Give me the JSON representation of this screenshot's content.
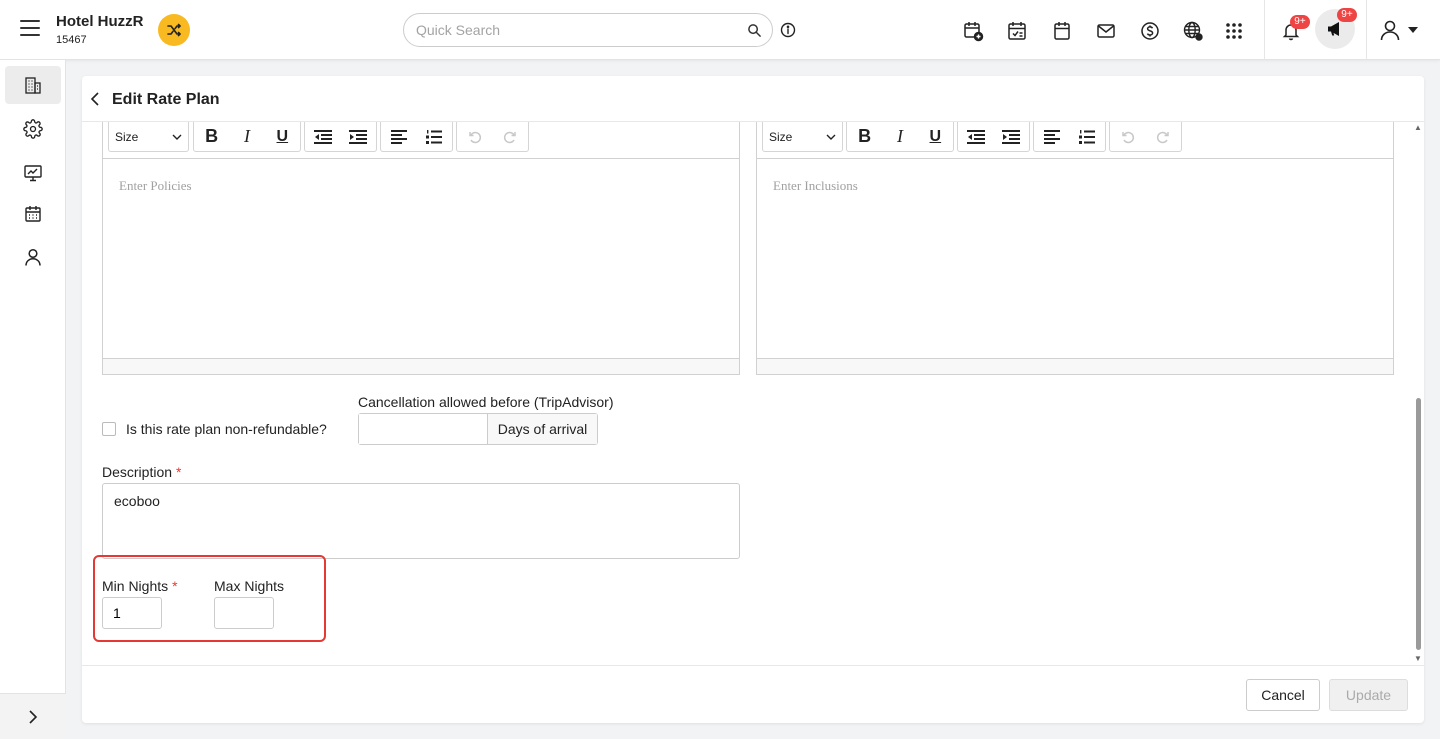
{
  "header": {
    "hotel_name": "Hotel HuzzR",
    "hotel_id": "15467",
    "search_placeholder": "Quick Search",
    "notification_badge": "9+",
    "announcement_badge": "9+",
    "accent_color": "#f9b921",
    "icons": [
      "menu-icon",
      "shuffle-icon",
      "search-icon",
      "info-icon",
      "calendar-add-icon",
      "calendar-check-icon",
      "calendar-icon",
      "mail-icon",
      "dollar-icon",
      "globe-icon",
      "apps-grid-icon",
      "bell-icon",
      "megaphone-icon",
      "user-icon",
      "caret-down-icon"
    ]
  },
  "sidebar": {
    "items": [
      "building-icon",
      "gear-icon",
      "monitor-icon",
      "calendar-grid-icon",
      "user-icon"
    ],
    "expand_icon": "chevron-right-icon"
  },
  "page": {
    "title": "Edit Rate Plan",
    "policies_editor": {
      "size_label": "Size",
      "placeholder": "Enter Policies"
    },
    "inclusions_editor": {
      "size_label": "Size",
      "placeholder": "Enter Inclusions"
    },
    "non_refundable_label": "Is this rate plan non-refundable?",
    "non_refundable_checked": false,
    "cancellation_label": "Cancellation allowed before (TripAdvisor)",
    "cancellation_value": "",
    "cancellation_addon": "Days of arrival",
    "description_label": "Description",
    "required_mark": "*",
    "description_value": "ecoboo",
    "min_nights_label": "Min Nights",
    "min_nights_value": "1",
    "max_nights_label": "Max Nights",
    "max_nights_value": "",
    "highlight_color": "#e53935"
  },
  "footer": {
    "cancel_label": "Cancel",
    "update_label": "Update"
  }
}
